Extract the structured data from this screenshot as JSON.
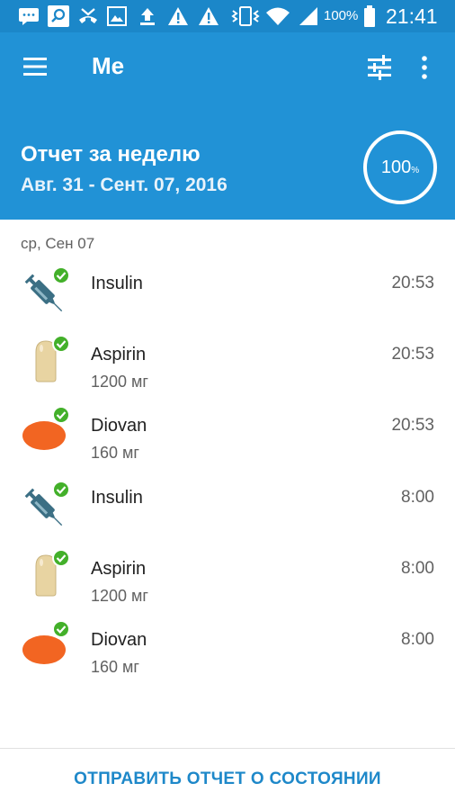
{
  "status_bar": {
    "battery": "100%",
    "time": "21:41",
    "icons": [
      "message-icon",
      "search-notification-icon",
      "missed-call-icon",
      "image-icon",
      "upload-icon",
      "warning-icon",
      "warning-icon",
      "vibrate-icon",
      "wifi-icon",
      "signal-icon",
      "battery-icon"
    ]
  },
  "app_bar": {
    "title": "Me",
    "icons": [
      "menu-icon",
      "filter-icon",
      "more-icon"
    ]
  },
  "report": {
    "title": "Отчет за неделю",
    "range": "Авг. 31 - Сент. 07, 2016",
    "percent": "100",
    "percent_unit": "%",
    "adherence": 1.0
  },
  "date_header": "ср, Сен 07",
  "entries": [
    {
      "name": "Insulin",
      "dose": "",
      "time": "20:53",
      "icon": "syringe-icon"
    },
    {
      "name": "Aspirin",
      "dose": "1200 мг",
      "time": "20:53",
      "icon": "capsule-icon"
    },
    {
      "name": "Diovan",
      "dose": "160 мг",
      "time": "20:53",
      "icon": "pill-icon"
    },
    {
      "name": "Insulin",
      "dose": "",
      "time": "8:00",
      "icon": "syringe-icon"
    },
    {
      "name": "Aspirin",
      "dose": "1200 мг",
      "time": "8:00",
      "icon": "capsule-icon"
    },
    {
      "name": "Diovan",
      "dose": "160 мг",
      "time": "8:00",
      "icon": "pill-icon"
    }
  ],
  "send_button": "ОТПРАВИТЬ ОТЧЕТ О СОСТОЯНИИ",
  "colors": {
    "primary": "#2192d6",
    "status_bar": "#1b87c9",
    "accent_text": "#1e88c9",
    "check": "#43b02a",
    "syringe": "#3b6f84",
    "capsule": "#e8d4a2",
    "pill": "#f26522"
  }
}
